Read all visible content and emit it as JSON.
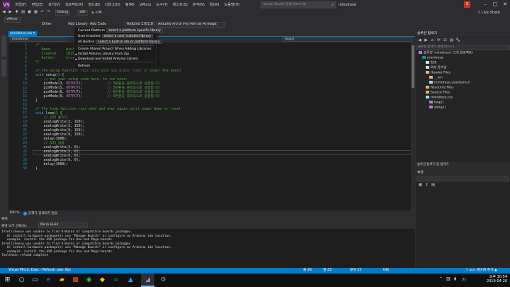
{
  "app": {
    "logo": "VS",
    "menus": [
      "파일(F)",
      "편집(E)",
      "보기(V)",
      "프로젝트(P)",
      "빌드(B)",
      "디버그(D)",
      "팀(M)",
      "vMicro",
      "도구(T)",
      "테스트(S)",
      "분석(N)",
      "창(W)",
      "도움말(H)"
    ],
    "quick_launch_placeholder": "Visual Studio 검색 (Ctrl+Q)",
    "quick_launch_icon": "search-icon",
    "solution_name": "minidrose",
    "user_initial": "S",
    "live_share": "Live Share"
  },
  "toolbar": {
    "config": "Debug",
    "platform": "x86",
    "run_label": "시작",
    "vmicro_combo": "vMicro",
    "other_label": "Other",
    "add_library": "Add Library",
    "add_code": "Add Code",
    "board_version": "Arduino 1.6/1.8",
    "board": "Arduino Pro or Pro Mini w/ ATmega"
  },
  "dropdown": {
    "items": [
      {
        "label": "Current Platform",
        "combo": "select a platform specific library"
      },
      {
        "label": "User Installed",
        "combo": "select a user installed library"
      },
      {
        "label": "All Built-in",
        "combo": "select a built-in ide or platform library"
      },
      {
        "label": "Create Shared Project When Adding Libraries",
        "combo": ""
      },
      {
        "label": "Install Arduino Library From Zip",
        "combo": ""
      },
      {
        "label": "Download and Install Arduino Library",
        "combo": ""
      },
      {
        "label": "Refresh",
        "combo": ""
      }
    ]
  },
  "editor": {
    "tab": "minidrose.ino",
    "nav_file": "minidrose",
    "nav_func": "loop()",
    "zoom": "100 %",
    "issues": "문제가 검색되지 않음",
    "lines": [
      {
        "n": "1",
        "parts": [
          {
            "t": "/*",
            "c": "comment"
          }
        ]
      },
      {
        "n": "2",
        "parts": [
          {
            "t": "   Name:       minidrose.ino",
            "c": "comment"
          }
        ]
      },
      {
        "n": "3",
        "parts": [
          {
            "t": "   Created:    2019-04-20 오전 10:54:00",
            "c": "comment"
          }
        ]
      },
      {
        "n": "4",
        "parts": [
          {
            "t": "   Author:     ercsbr",
            "c": "comment"
          }
        ]
      },
      {
        "n": "5",
        "parts": [
          {
            "t": "*/",
            "c": "comment"
          }
        ]
      },
      {
        "n": "6",
        "parts": []
      },
      {
        "n": "7",
        "parts": [
          {
            "t": "// The setup function runs once when you press reset or power the board",
            "c": "comment"
          }
        ]
      },
      {
        "n": "8",
        "parts": [
          {
            "t": "void",
            "c": "kw"
          },
          {
            "t": " setup() {",
            "c": "text"
          }
        ]
      },
      {
        "n": "9",
        "parts": [
          {
            "t": "    // put your setup code here, to run once:",
            "c": "comment"
          }
        ]
      },
      {
        "n": "10",
        "parts": [
          {
            "t": "    pinMode(3, ",
            "c": "text"
          },
          {
            "t": "OUTPUT",
            "c": "const"
          },
          {
            "t": ");",
            "c": "text"
          },
          {
            "t": "            // 3번핀을 출력모드로 설정합니다",
            "c": "comment"
          }
        ]
      },
      {
        "n": "11",
        "parts": [
          {
            "t": "    pinMode(5, ",
            "c": "text"
          },
          {
            "t": "OUTPUT",
            "c": "const"
          },
          {
            "t": ");",
            "c": "text"
          },
          {
            "t": "            // 5번핀을 출력모드로 설정합니다",
            "c": "comment"
          }
        ]
      },
      {
        "n": "12",
        "parts": [
          {
            "t": "    pinMode(6, ",
            "c": "text"
          },
          {
            "t": "OUTPUT",
            "c": "const"
          },
          {
            "t": ");",
            "c": "text"
          },
          {
            "t": "            // 6번핀을 출력모드로 설정합니다",
            "c": "comment"
          }
        ]
      },
      {
        "n": "13",
        "parts": [
          {
            "t": "    pinMode(9, ",
            "c": "text"
          },
          {
            "t": "OUTPUT",
            "c": "const"
          },
          {
            "t": ");",
            "c": "text"
          },
          {
            "t": "            // 9번핀을 출력모드로 설정합니다",
            "c": "comment"
          }
        ]
      },
      {
        "n": "14",
        "parts": [
          {
            "t": "}",
            "c": "text"
          }
        ]
      },
      {
        "n": "15",
        "parts": []
      },
      {
        "n": "16",
        "parts": [
          {
            "t": "// The loop function runs over and over again until power down or reset",
            "c": "comment"
          }
        ]
      },
      {
        "n": "17",
        "parts": [
          {
            "t": "void",
            "c": "kw"
          },
          {
            "t": " loop() {",
            "c": "text"
          }
        ]
      },
      {
        "n": "18",
        "parts": [
          {
            "t": "    // 모터 돌리기",
            "c": "comment"
          }
        ]
      },
      {
        "n": "19",
        "parts": [
          {
            "t": "    analogWrite(3, 150);",
            "c": "text"
          }
        ]
      },
      {
        "n": "20",
        "parts": [
          {
            "t": "    analogWrite(5, 150);",
            "c": "text"
          }
        ]
      },
      {
        "n": "21",
        "parts": [
          {
            "t": "    analogWrite(6, 150);",
            "c": "text"
          }
        ]
      },
      {
        "n": "22",
        "parts": [
          {
            "t": "    analogWrite(9, 150);",
            "c": "text"
          }
        ]
      },
      {
        "n": "23",
        "parts": [
          {
            "t": "    delay(3000);",
            "c": "text"
          }
        ]
      },
      {
        "n": "24",
        "parts": [
          {
            "t": "    // 모터 멈춤",
            "c": "comment"
          }
        ]
      },
      {
        "n": "25",
        "parts": [
          {
            "t": "    analogWrite(3, 0);",
            "c": "text"
          }
        ]
      },
      {
        "n": "26",
        "parts": [
          {
            "t": "    analogWrite(5, 0);",
            "c": "text"
          }
        ]
      },
      {
        "n": "27",
        "parts": [
          {
            "t": "    analogWrite(6, 0);",
            "c": "text"
          }
        ]
      },
      {
        "n": "28",
        "parts": [
          {
            "t": "    analogWrite(9, 0);",
            "c": "text"
          }
        ]
      },
      {
        "n": "29",
        "parts": [
          {
            "t": "    delay(3000);",
            "c": "text"
          }
        ]
      },
      {
        "n": "30",
        "parts": [
          {
            "t": "}",
            "c": "text"
          }
        ]
      }
    ]
  },
  "solution_explorer": {
    "title": "솔루션 탐색기",
    "search_placeholder": "솔루션 탐색기 검색(Ctrl+;)",
    "tree": [
      {
        "label": "솔루션 'minidrose' (1개 프로젝트)",
        "indent": 0,
        "icon": "solution"
      },
      {
        "label": "minidrose",
        "indent": 1,
        "icon": "project"
      },
      {
        "label": "참조",
        "indent": 2,
        "icon": "refs"
      },
      {
        "label": "외부 종속성",
        "indent": 2,
        "icon": "deps"
      },
      {
        "label": "Header Files",
        "indent": 2,
        "icon": "folder"
      },
      {
        "label": "__vm",
        "indent": 3,
        "icon": "folder"
      },
      {
        "label": "minidrose.vsarduino.h",
        "indent": 3,
        "icon": "file"
      },
      {
        "label": "Resource Files",
        "indent": 2,
        "icon": "folder"
      },
      {
        "label": "Source Files",
        "indent": 2,
        "icon": "folder"
      },
      {
        "label": "minidrose.ino",
        "indent": 2,
        "icon": "file"
      },
      {
        "label": "loop()",
        "indent": 3,
        "icon": "method"
      },
      {
        "label": "setup()",
        "indent": 3,
        "icon": "method"
      }
    ],
    "tabs": "솔루션 탐색기   팀 탐색기"
  },
  "properties": {
    "title": "속성"
  },
  "output": {
    "title": "출력",
    "source_label": "출력 보기 선택(S):",
    "source": "Micro Build",
    "lines": [
      "IntelliSense was unable to find Arduino or compatible boards packages.",
      "   Or install hardware package(s) use \"Manage Boards\" or configure an Arduino ide location.",
      "   example: install the AVR package for Uno and Mega boards.",
      "IntelliSense was unable to find Arduino or compatible boards packages.",
      "   Or install hardware package(s) use \"Manage Boards\" or configure an Arduino ide location.",
      "   example: install the AVR package for Uno and Mega boards.",
      "Toolchain reload complete"
    ]
  },
  "statusbar": {
    "left": "Visual Micro: Exec - Refresh user libs",
    "line": "줄 26",
    "col": "열 23",
    "ch": "문자 23",
    "mode": "INS",
    "right": "↑ 소스 제어에 추가 ▲"
  },
  "taskbar": {
    "time": "오후 10:54",
    "date": "2019-04-20"
  },
  "colors": {
    "accent": "#007acc",
    "background": "#2d2d30",
    "editor": "#1e1e1e"
  }
}
